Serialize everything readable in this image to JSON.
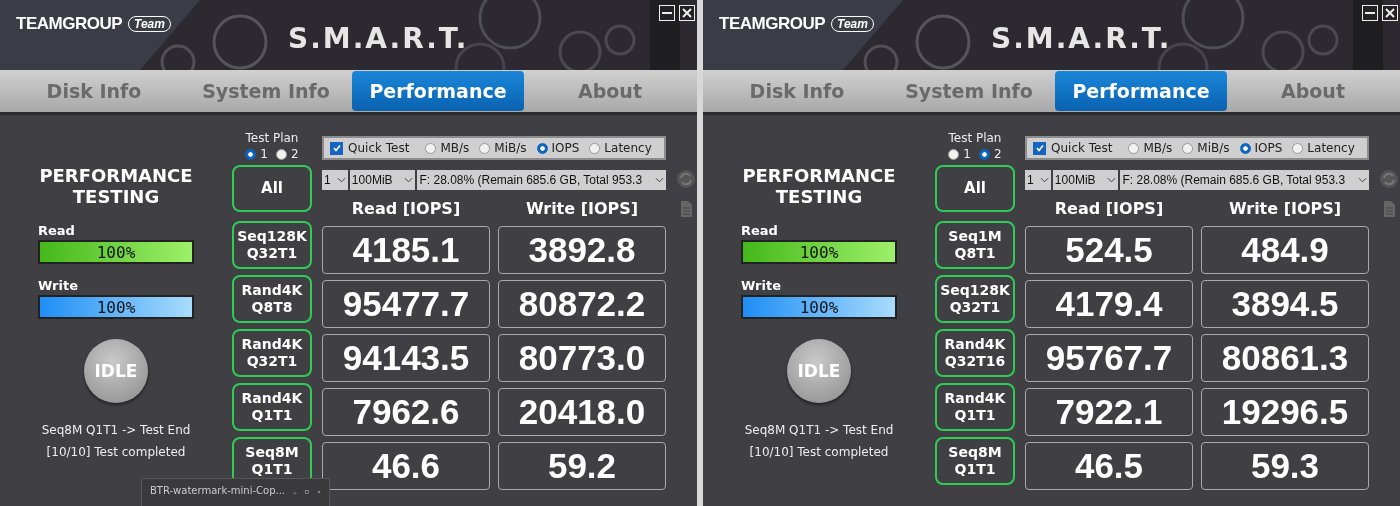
{
  "windows": [
    {
      "brand": "TEAMGROUP",
      "brand_badge": "Team",
      "title": "S.M.A.R.T.",
      "tabs": [
        {
          "label": "Disk Info",
          "selected": false
        },
        {
          "label": "System Info",
          "selected": false
        },
        {
          "label": "Performance",
          "selected": true
        },
        {
          "label": "About",
          "selected": false
        }
      ],
      "heading": "PERFORMANCE TESTING",
      "meters": [
        {
          "label": "Read",
          "level": 1,
          "reading": "100%",
          "kind": "read"
        },
        {
          "label": "Write",
          "level": 1,
          "reading": "100%",
          "kind": "write"
        }
      ],
      "state_button": "IDLE",
      "status_lines": [
        "Seq8M Q1T1 -> Test End",
        "[10/10] Test completed"
      ],
      "test_plan": {
        "label": "Test Plan",
        "options": [
          {
            "label": "1",
            "selected": true
          },
          {
            "label": "2",
            "selected": false
          }
        ]
      },
      "quick_test": {
        "label": "Quick Test",
        "checked": true
      },
      "units": [
        {
          "label": "MB/s",
          "selected": false
        },
        {
          "label": "MiB/s",
          "selected": false
        },
        {
          "label": "IOPS",
          "selected": true
        },
        {
          "label": "Latency",
          "selected": false
        }
      ],
      "dropdowns": [
        "1",
        "100MiB",
        "F: 28.08% (Remain 685.6 GB, Total 953.3"
      ],
      "all_button": "All",
      "columns": [
        "Read [IOPS]",
        "Write [IOPS]"
      ],
      "rows": [
        {
          "test": [
            "Seq128K",
            "Q32T1"
          ],
          "read": "4185.1",
          "write": "3892.8"
        },
        {
          "test": [
            "Rand4K",
            "Q8T8"
          ],
          "read": "95477.7",
          "write": "80872.2"
        },
        {
          "test": [
            "Rand4K",
            "Q32T1"
          ],
          "read": "94143.5",
          "write": "80773.0"
        },
        {
          "test": [
            "Rand4K",
            "Q1T1"
          ],
          "read": "7962.6",
          "write": "20418.0"
        },
        {
          "test": [
            "Seq8M",
            "Q1T1"
          ],
          "read": "46.6",
          "write": "59.2"
        }
      ],
      "popup": {
        "title": "BTR-watermark-mini-Cop..."
      }
    },
    {
      "brand": "TEAMGROUP",
      "brand_badge": "Team",
      "title": "S.M.A.R.T.",
      "tabs": [
        {
          "label": "Disk Info",
          "selected": false
        },
        {
          "label": "System Info",
          "selected": false
        },
        {
          "label": "Performance",
          "selected": true
        },
        {
          "label": "About",
          "selected": false
        }
      ],
      "heading": "PERFORMANCE TESTING",
      "meters": [
        {
          "label": "Read",
          "level": 1,
          "reading": "100%",
          "kind": "read"
        },
        {
          "label": "Write",
          "level": 1,
          "reading": "100%",
          "kind": "write"
        }
      ],
      "state_button": "IDLE",
      "status_lines": [
        "Seq8M Q1T1 -> Test End",
        "[10/10] Test completed"
      ],
      "test_plan": {
        "label": "Test Plan",
        "options": [
          {
            "label": "1",
            "selected": false
          },
          {
            "label": "2",
            "selected": true
          }
        ]
      },
      "quick_test": {
        "label": "Quick Test",
        "checked": true
      },
      "units": [
        {
          "label": "MB/s",
          "selected": false
        },
        {
          "label": "MiB/s",
          "selected": false
        },
        {
          "label": "IOPS",
          "selected": true
        },
        {
          "label": "Latency",
          "selected": false
        }
      ],
      "dropdowns": [
        "1",
        "100MiB",
        "F: 28.08% (Remain 685.6 GB, Total 953.3"
      ],
      "all_button": "All",
      "columns": [
        "Read [IOPS]",
        "Write [IOPS]"
      ],
      "rows": [
        {
          "test": [
            "Seq1M",
            "Q8T1"
          ],
          "read": "524.5",
          "write": "484.9"
        },
        {
          "test": [
            "Seq128K",
            "Q32T1"
          ],
          "read": "4179.4",
          "write": "3894.5"
        },
        {
          "test": [
            "Rand4K",
            "Q32T16"
          ],
          "read": "95767.7",
          "write": "80861.3"
        },
        {
          "test": [
            "Rand4K",
            "Q1T1"
          ],
          "read": "7922.1",
          "write": "19296.5"
        },
        {
          "test": [
            "Seq8M",
            "Q1T1"
          ],
          "read": "46.5",
          "write": "59.3"
        }
      ]
    }
  ]
}
